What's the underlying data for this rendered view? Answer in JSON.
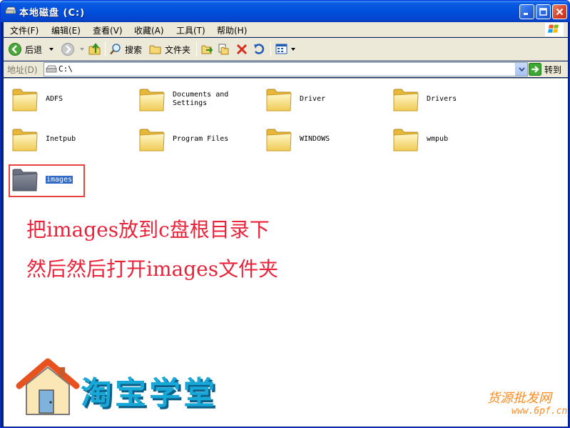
{
  "window": {
    "title": "本地磁盘 (C:)"
  },
  "menu": [
    {
      "label": "文件(F)"
    },
    {
      "label": "编辑(E)"
    },
    {
      "label": "查看(V)"
    },
    {
      "label": "收藏(A)"
    },
    {
      "label": "工具(T)"
    },
    {
      "label": "帮助(H)"
    }
  ],
  "toolbar": {
    "back_label": "后退",
    "search_label": "搜索",
    "folders_label": "文件夹"
  },
  "address": {
    "label": "地址(D)",
    "value": "C:\\",
    "go_label": "转到"
  },
  "folders": [
    {
      "name": "ADFS"
    },
    {
      "name": "Documents and\nSettings"
    },
    {
      "name": "Driver"
    },
    {
      "name": "Drivers"
    },
    {
      "name": "Inetpub"
    },
    {
      "name": "Program Files"
    },
    {
      "name": "WINDOWS"
    },
    {
      "name": "wmpub"
    },
    {
      "name": "images"
    }
  ],
  "instructions": {
    "line1": "把images放到c盘根目录下",
    "line2": "然后然后打开images文件夹"
  },
  "logo": {
    "text": "淘宝学堂"
  },
  "watermark": {
    "name": "货源批发网",
    "url": "www.6pf.cn"
  },
  "colors": {
    "titlebar": "#0054e3",
    "folder": "#f7d774",
    "annotation": "#e8233a",
    "highlight": "#316ac5"
  }
}
